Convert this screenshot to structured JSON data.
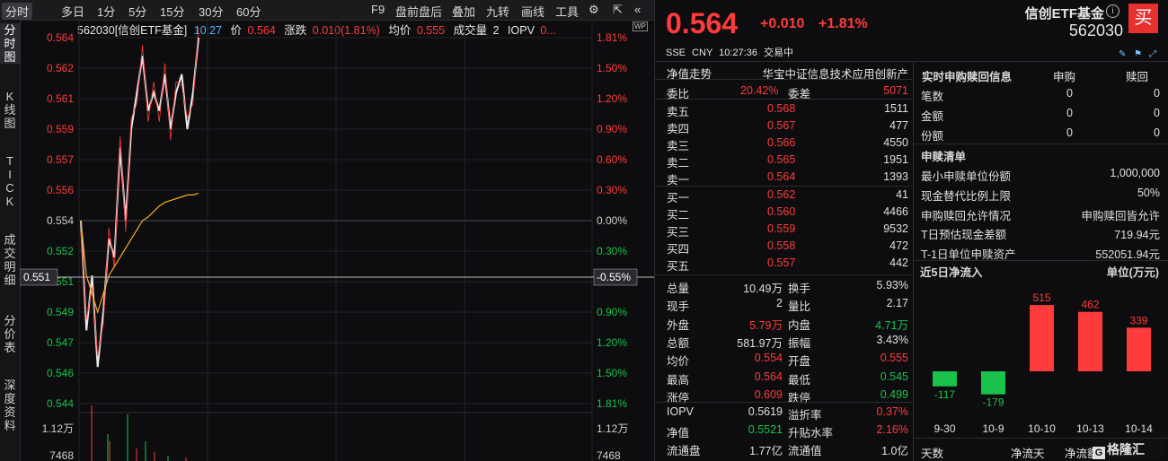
{
  "toolbar": {
    "tabs": [
      "分时",
      "多日",
      "1分",
      "5分",
      "15分",
      "30分",
      "60分"
    ],
    "right_items": [
      "F9",
      "盘前盘后",
      "叠加",
      "九转",
      "画线",
      "工具"
    ]
  },
  "sidetabs": [
    "分\n时\n图",
    "K\n线\n图",
    "T\nI\nC\nK",
    "成\n交\n明\n细",
    "分\n价\n表",
    "深\n度\n资\n料"
  ],
  "chart_info": {
    "code_name": "562030[信创ETF基金]",
    "time": "10:27",
    "price_label": "价",
    "price": "0.564",
    "change_label": "涨跌",
    "change": "0.010(1.81%)",
    "avg_label": "均价",
    "avg": "0.555",
    "vol_label": "成交量",
    "vol": "2",
    "iopv_label": "IOPV",
    "iopv": "0...",
    "wp_icon": "WP"
  },
  "chart_data": {
    "type": "line",
    "title": "",
    "ylim": [
      0.544,
      0.564
    ],
    "y_ticks_left": [
      "0.564",
      "0.562",
      "0.561",
      "0.559",
      "0.557",
      "0.556",
      "0.554",
      "0.552",
      "0.551",
      "0.549",
      "0.547",
      "0.546",
      "0.544"
    ],
    "y_ticks_right": [
      "1.81%",
      "1.50%",
      "1.20%",
      "0.90%",
      "0.60%",
      "0.30%",
      "0.00%",
      "0.30%",
      "-0.55%",
      "0.90%",
      "1.20%",
      "1.50%",
      "1.81%"
    ],
    "crosshair_left": "0.551",
    "crosshair_right": "-0.55%",
    "vol_ticks_left": [
      "1.12万",
      "7468"
    ],
    "vol_ticks_right": [
      "1.12万",
      "7468"
    ],
    "series": [
      {
        "values": [
          0.554,
          0.548,
          0.551,
          0.546,
          0.549,
          0.553,
          0.552,
          0.558,
          0.554,
          0.559,
          0.561,
          0.563,
          0.56,
          0.561,
          0.56,
          0.562,
          0.559,
          0.561,
          0.562,
          0.559,
          0.561,
          0.564
        ]
      },
      {
        "values": [
          0.554,
          0.551,
          0.55,
          0.549,
          0.55,
          0.551,
          0.5515,
          0.552,
          0.5525,
          0.553,
          0.5535,
          0.554,
          0.5542,
          0.5545,
          0.5548,
          0.555,
          0.5551,
          0.5552,
          0.5553,
          0.5554,
          0.5554,
          0.5555
        ]
      }
    ]
  },
  "quote": {
    "price": "0.564",
    "change": "+0.010",
    "pct": "+1.81%",
    "name": "信创ETF基金",
    "code": "562030",
    "buy_btn": "买",
    "market": "SSE",
    "currency": "CNY",
    "time": "10:27:36",
    "status": "交易中"
  },
  "nav": {
    "label": "净值走势",
    "index": "华宝中证信息技术应用创新产"
  },
  "order_ratio": {
    "ratio_label": "委比",
    "ratio": "20.42%",
    "diff_label": "委差",
    "diff": "5071"
  },
  "asks": [
    {
      "label": "卖五",
      "price": "0.568",
      "vol": "1511"
    },
    {
      "label": "卖四",
      "price": "0.567",
      "vol": "477"
    },
    {
      "label": "卖三",
      "price": "0.566",
      "vol": "4550"
    },
    {
      "label": "卖二",
      "price": "0.565",
      "vol": "1951"
    },
    {
      "label": "卖一",
      "price": "0.564",
      "vol": "1393"
    }
  ],
  "bids": [
    {
      "label": "买一",
      "price": "0.562",
      "vol": "41"
    },
    {
      "label": "买二",
      "price": "0.560",
      "vol": "4466"
    },
    {
      "label": "买三",
      "price": "0.559",
      "vol": "9532"
    },
    {
      "label": "买四",
      "price": "0.558",
      "vol": "472"
    },
    {
      "label": "买五",
      "price": "0.557",
      "vol": "442"
    }
  ],
  "stats": [
    {
      "l1": "总量",
      "v1": "10.49万",
      "c1": "white",
      "l2": "换手",
      "v2": "5.93%",
      "c2": "white"
    },
    {
      "l1": "现手",
      "v1": "2",
      "c1": "white",
      "l2": "量比",
      "v2": "2.17",
      "c2": "white"
    },
    {
      "l1": "外盘",
      "v1": "5.79万",
      "c1": "red",
      "l2": "内盘",
      "v2": "4.71万",
      "c2": "green"
    },
    {
      "l1": "总额",
      "v1": "581.97万",
      "c1": "white",
      "l2": "振幅",
      "v2": "3.43%",
      "c2": "white"
    },
    {
      "l1": "均价",
      "v1": "0.554",
      "c1": "red",
      "l2": "开盘",
      "v2": "0.555",
      "c2": "red"
    },
    {
      "l1": "最高",
      "v1": "0.564",
      "c1": "red",
      "l2": "最低",
      "v2": "0.545",
      "c2": "green"
    },
    {
      "l1": "涨停",
      "v1": "0.609",
      "c1": "red",
      "l2": "跌停",
      "v2": "0.499",
      "c2": "green"
    }
  ],
  "stats2": [
    {
      "l1": "IOPV",
      "v1": "0.5619",
      "c1": "white",
      "l2": "溢折率",
      "v2": "0.37%",
      "c2": "red"
    },
    {
      "l1": "净值",
      "v1": "0.5521",
      "c1": "green",
      "l2": "升贴水率",
      "v2": "2.16%",
      "c2": "red"
    },
    {
      "l1": "流通盘",
      "v1": "1.77亿",
      "c1": "white",
      "l2": "流通值",
      "v2": "1.0亿",
      "c2": "white"
    }
  ],
  "realtime": {
    "title": "实时申购赎回信息",
    "col1": "申购",
    "col2": "赎回",
    "rows": [
      {
        "l": "笔数",
        "a": "0",
        "b": "0"
      },
      {
        "l": "金额",
        "a": "0",
        "b": "0"
      },
      {
        "l": "份额",
        "a": "0",
        "b": "0"
      }
    ]
  },
  "redemption": {
    "title": "申赎清单",
    "rows": [
      {
        "l": "最小申赎单位份额",
        "v": "1,000,000"
      },
      {
        "l": "现金替代比例上限",
        "v": "50%"
      },
      {
        "l": "申购赎回允许情况",
        "v": "申购赎回皆允许"
      },
      {
        "l": "T日预估现金差额",
        "v": "719.94元"
      },
      {
        "l": "T-1日单位申赎资产",
        "v": "552051.94元"
      }
    ]
  },
  "inflow": {
    "title": "近5日净流入",
    "unit": "单位(万元)",
    "footer": [
      "天数",
      "净流天",
      "净流额"
    ],
    "watermark": "格隆汇"
  },
  "inflow_chart": {
    "type": "bar",
    "categories": [
      "9-30",
      "10-9",
      "10-10",
      "10-13",
      "10-14"
    ],
    "values": [
      -117,
      -179,
      515,
      462,
      339
    ],
    "pos_color": "#ff3b3b",
    "neg_color": "#19c24b"
  }
}
